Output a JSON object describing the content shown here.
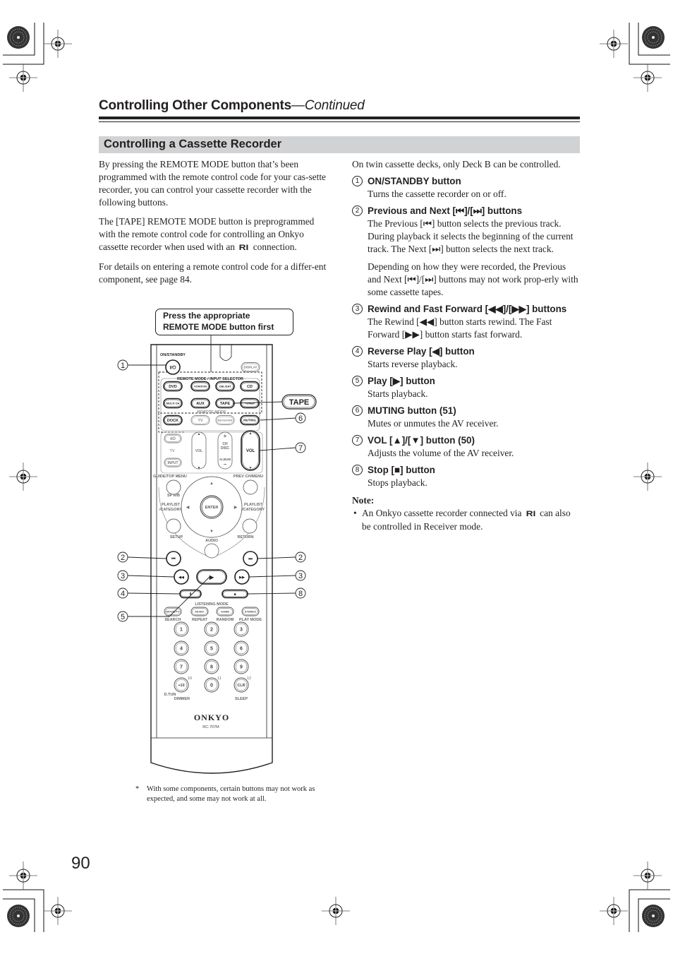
{
  "header": {
    "title": "Controlling Other Components",
    "continued": "—Continued"
  },
  "section": {
    "title": "Controlling a Cassette Recorder"
  },
  "left_column": {
    "paragraphs": [
      "By pressing the REMOTE MODE button that’s been programmed with the remote control code for your cas-sette recorder, you can control your cassette recorder with the following buttons.",
      "The [TAPE] REMOTE MODE button is preprogrammed with the remote control code for controlling an Onkyo cassette recorder when used with an",
      "For details on entering a remote control code for a differ-ent component, see page 84."
    ],
    "ri_after": "connection.",
    "ri_label": "RI"
  },
  "right_column": {
    "intro": "On twin cassette decks, only Deck B can be controlled.",
    "items": [
      {
        "num": "1",
        "title": "ON/STANDBY button",
        "desc": [
          "Turns the cassette recorder on or off."
        ]
      },
      {
        "num": "2",
        "title_pre": "Previous and Next [",
        "title_post": "] buttons",
        "desc": [
          "The Previous [⏮] button selects the previous track. During playback it selects the beginning of the current track. The Next [⏭] button selects the next track.",
          "Depending on how they were recorded, the Previous and Next [⏮]/[⏭] buttons may not work prop-erly with some cassette tapes."
        ]
      },
      {
        "num": "3",
        "title_pre": "Rewind and Fast Forward [",
        "title_post": "] buttons",
        "desc": [
          "The Rewind [◀◀] button starts rewind. The Fast Forward [▶▶] button starts fast forward."
        ]
      },
      {
        "num": "4",
        "title": "Reverse Play [◀] button",
        "desc": [
          "Starts reverse playback."
        ]
      },
      {
        "num": "5",
        "title": "Play [▶] button",
        "desc": [
          "Starts playback."
        ]
      },
      {
        "num": "6",
        "title": "MUTING button (51)",
        "desc": [
          "Mutes or unmutes the AV receiver."
        ]
      },
      {
        "num": "7",
        "title": "VOL [▲]/[▼] button (50)",
        "desc": [
          "Adjusts the volume of the AV receiver."
        ]
      },
      {
        "num": "8",
        "title": "Stop [■] button",
        "desc": [
          "Stops playback."
        ]
      }
    ],
    "item2_title": "Previous and Next [⏮]/[⏭] buttons",
    "item3_title": "Rewind and Fast Forward [◀◀]/[▶▶] buttons",
    "note_heading": "Note:",
    "note_pre": "An Onkyo cassette recorder connected via",
    "note_post": "can also be controlled in Receiver mode.",
    "note_bullet": "•"
  },
  "figure": {
    "callout": [
      "Press the appropriate",
      "REMOTE MODE button first"
    ],
    "tape_label": "TAPE",
    "callout_numbers": [
      "1",
      "2",
      "3",
      "4",
      "5",
      "2",
      "3",
      "8",
      "6",
      "7"
    ],
    "remote": {
      "on_standby": "ON/STANDBY",
      "power_glyph": "I/⏻",
      "display": "DISPLAY",
      "selector_title": "REMOTE MODE / INPUT SELECTOR",
      "row1": [
        "DVD",
        "VCR/DVR",
        "CBL/SAT",
        "CD"
      ],
      "row2": [
        "MULTI CH",
        "AUX",
        "TAPE",
        "TUNER"
      ],
      "remote_mode": "REMOTE MODE",
      "row3": [
        "DOCK",
        "TV",
        "RECEIVER",
        "MUTING"
      ],
      "tv_power": "I/⏻",
      "tv": "TV",
      "input": "INPUT",
      "vol_small": "VOL",
      "ch_disc": [
        "+",
        "CH",
        "DISC",
        "ALBUM",
        "−"
      ],
      "vol": "VOL",
      "guide": "GUIDE/TOP MENU",
      "prev_ch": "PREV CH/MENU",
      "sp_ab": "SP A/B",
      "playlist_left": [
        "PLAYLIST",
        "/CATEGORY"
      ],
      "playlist_right": [
        "PLAYLIST",
        "/CATEGORY"
      ],
      "enter": "ENTER",
      "setup": "SETUP",
      "audio": "AUDIO",
      "return": "RETURN",
      "listening_mode": "LISTENING MODE",
      "mode_buttons": [
        "MOVIE/TV",
        "MUSIC",
        "GAME",
        "STEREO"
      ],
      "mode_sublabels": [
        "SEARCH",
        "REPEAT",
        "RANDOM",
        "PLAY MODE"
      ],
      "numpad": [
        "1",
        "2",
        "3",
        "4",
        "5",
        "6",
        "7",
        "8",
        "9",
        "+10",
        "0",
        "CLR"
      ],
      "numpad_sup": [
        "10",
        "11",
        "12"
      ],
      "d_tun": "D.TUN",
      "dimmer": "DIMMER",
      "sleep": "SLEEP",
      "brand": "ONKYO",
      "model": "RC-707M"
    },
    "footnote_star": "*",
    "footnote": "With some components, certain buttons may not work as expected, and some may not work at all."
  },
  "page_number": "90"
}
